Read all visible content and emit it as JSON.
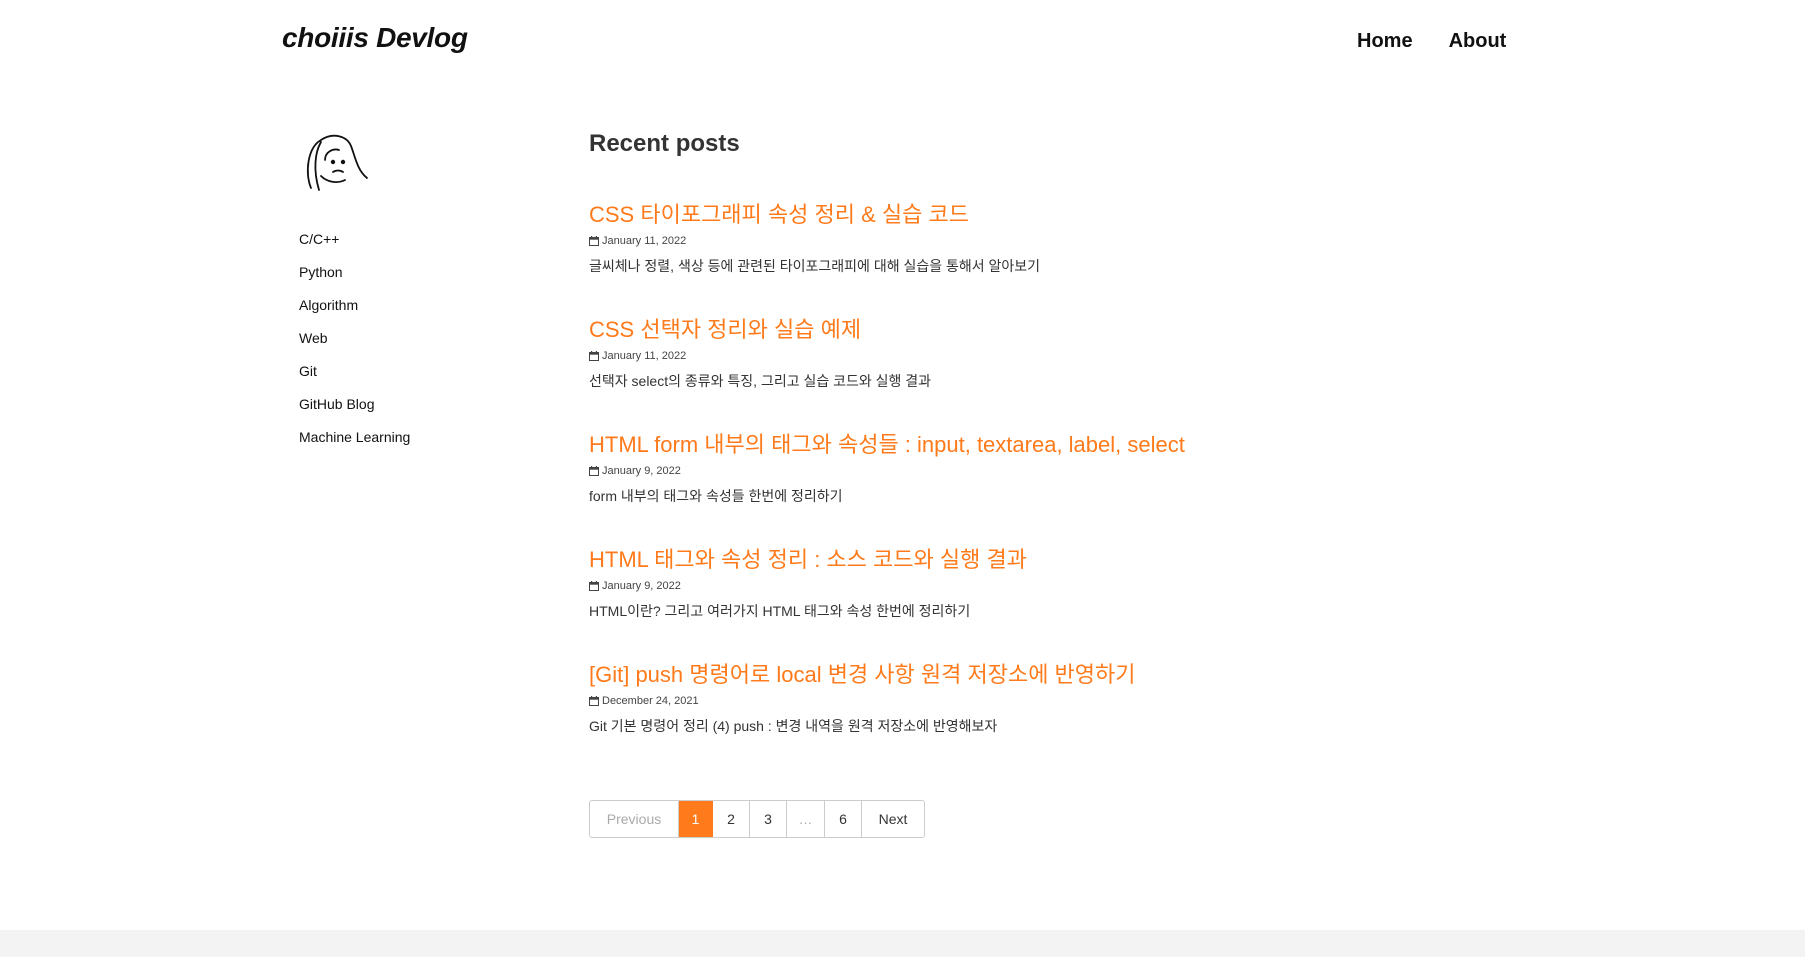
{
  "header": {
    "brand": "choiiis Devlog",
    "nav": [
      {
        "label": "Home"
      },
      {
        "label": "About"
      }
    ]
  },
  "sidebar": {
    "avatar_icon": "avatar-line-drawing",
    "categories": [
      {
        "label": "C/C++"
      },
      {
        "label": "Python"
      },
      {
        "label": "Algorithm"
      },
      {
        "label": "Web"
      },
      {
        "label": "Git"
      },
      {
        "label": "GitHub Blog"
      },
      {
        "label": "Machine Learning"
      }
    ]
  },
  "main": {
    "section_title": "Recent posts",
    "posts": [
      {
        "title": "CSS 타이포그래피 속성 정리 & 실습 코드",
        "date": "January 11, 2022",
        "excerpt": "글씨체나 정렬, 색상 등에 관련된 타이포그래피에 대해 실습을 통해서 알아보기"
      },
      {
        "title": "CSS 선택자 정리와 실습 예제",
        "date": "January 11, 2022",
        "excerpt": "선택자 select의 종류와 특징, 그리고 실습 코드와 실행 결과"
      },
      {
        "title": "HTML form 내부의 태그와 속성들 : input, textarea, label, select",
        "date": "January 9, 2022",
        "excerpt": "form 내부의 태그와 속성들 한번에 정리하기"
      },
      {
        "title": "HTML 태그와 속성 정리 : 소스 코드와 실행 결과",
        "date": "January 9, 2022",
        "excerpt": "HTML이란? 그리고 여러가지 HTML 태그와 속성 한번에 정리하기"
      },
      {
        "title": "[Git] push 명령어로 local 변경 사항 원격 저장소에 반영하기",
        "date": "December 24, 2021",
        "excerpt": "Git 기본 명령어 정리 (4) push : 변경 내역을 원격 저장소에 반영해보자"
      }
    ]
  },
  "pagination": {
    "previous": "Previous",
    "pages": [
      "1",
      "2",
      "3",
      "…",
      "6"
    ],
    "current": "1",
    "next": "Next"
  },
  "colors": {
    "accent": "#ff7a1a",
    "footer_bg": "#f3f3f3"
  }
}
